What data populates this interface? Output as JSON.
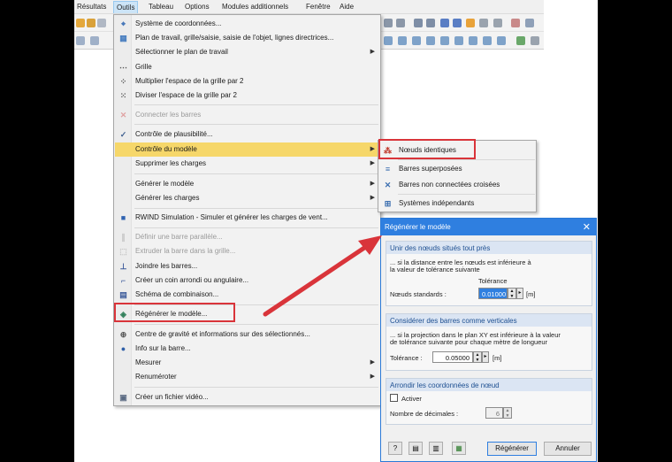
{
  "menubar": {
    "items": [
      "Résultats",
      "Outils",
      "Tableau",
      "Options",
      "Modules additionnels",
      "Fenêtre",
      "Aide"
    ]
  },
  "outils_menu": {
    "items": [
      {
        "label": "Système de coordonnées...",
        "icon": "coordinate-system-icon"
      },
      {
        "label": "Plan de travail, grille/saisie, saisie de l'objet, lignes directrices...",
        "icon": "work-plane-icon"
      },
      {
        "label": "Sélectionner le plan de travail",
        "icon": "",
        "submenu": true
      },
      {
        "label": "Grille",
        "icon": "grid-icon"
      },
      {
        "label": "Multiplier l'espace de la grille par 2",
        "icon": "grid-multiply-icon"
      },
      {
        "label": "Diviser l'espace de la grille par 2",
        "icon": "grid-divide-icon"
      },
      {
        "label": "Connecter les barres",
        "icon": "connect-members-icon",
        "disabled": true
      },
      {
        "label": "Contrôle de plausibilité...",
        "icon": "plausibility-check-icon"
      },
      {
        "label": "Contrôle du modèle",
        "icon": "",
        "submenu": true,
        "highlighted": true
      },
      {
        "label": "Supprimer les charges",
        "icon": "",
        "submenu": true
      },
      {
        "label": "Générer le modèle",
        "icon": "",
        "submenu": true
      },
      {
        "label": "Générer les charges",
        "icon": "",
        "submenu": true
      },
      {
        "label": "RWIND Simulation - Simuler et générer les charges de vent...",
        "icon": "rwind-icon"
      },
      {
        "label": "Définir une barre parallèle...",
        "icon": "parallel-member-icon",
        "disabled": true
      },
      {
        "label": "Extruder la barre dans la grille...",
        "icon": "extrude-member-icon",
        "disabled": true
      },
      {
        "label": "Joindre les barres...",
        "icon": "join-members-icon"
      },
      {
        "label": "Créer un coin arrondi ou angulaire...",
        "icon": "round-corner-icon"
      },
      {
        "label": "Schéma de combinaison...",
        "icon": "combination-scheme-icon"
      },
      {
        "label": "Régénérer le modèle...",
        "icon": "regenerate-model-icon"
      },
      {
        "label": "Centre de gravité et informations sur des sélectionnés...",
        "icon": "center-of-gravity-icon"
      },
      {
        "label": "Info sur la barre...",
        "icon": "member-info-icon"
      },
      {
        "label": "Mesurer",
        "icon": "",
        "submenu": true
      },
      {
        "label": "Renuméroter",
        "icon": "",
        "submenu": true
      },
      {
        "label": "Créer un fichier vidéo...",
        "icon": "video-file-icon"
      }
    ]
  },
  "controle_submenu": {
    "items": [
      {
        "label": "Nœuds identiques",
        "icon": "identical-nodes-icon"
      },
      {
        "label": "Barres superposées",
        "icon": "overlapping-members-icon"
      },
      {
        "label": "Barres non connectées croisées",
        "icon": "crossing-members-icon"
      },
      {
        "label": "Systèmes indépendants",
        "icon": "independent-systems-icon"
      }
    ]
  },
  "dialog": {
    "title": "Régénérer le modèle",
    "close": "✕",
    "group1": {
      "header": "Unir des nœuds situés tout près",
      "line1": "... si la distance entre les nœuds est inférieure à",
      "line2": "la valeur de tolérance suivante",
      "col_header": "Tolérance",
      "field_label": "Nœuds standards :",
      "field_value": "0.01000",
      "unit": "[m]"
    },
    "group2": {
      "header": "Considérer des barres comme verticales",
      "line1": "... si la projection dans le plan XY est inférieure à la valeur",
      "line2": "de tolérance suivante pour chaque mètre de longueur",
      "field_label": "Tolérance :",
      "field_value": "0.05000",
      "unit": "[m]"
    },
    "group3": {
      "header": "Arrondir les coordonnées de nœud",
      "checkbox_label": "Activer",
      "checked": false,
      "decimals_label": "Nombre de décimales :",
      "decimals_value": "6"
    },
    "buttons": {
      "regenerate": "Régénérer",
      "cancel": "Annuler"
    }
  },
  "colors": {
    "highlight": "#f6d76a",
    "annotation_red": "#d9343a",
    "dialog_title": "#2f7fe0"
  }
}
